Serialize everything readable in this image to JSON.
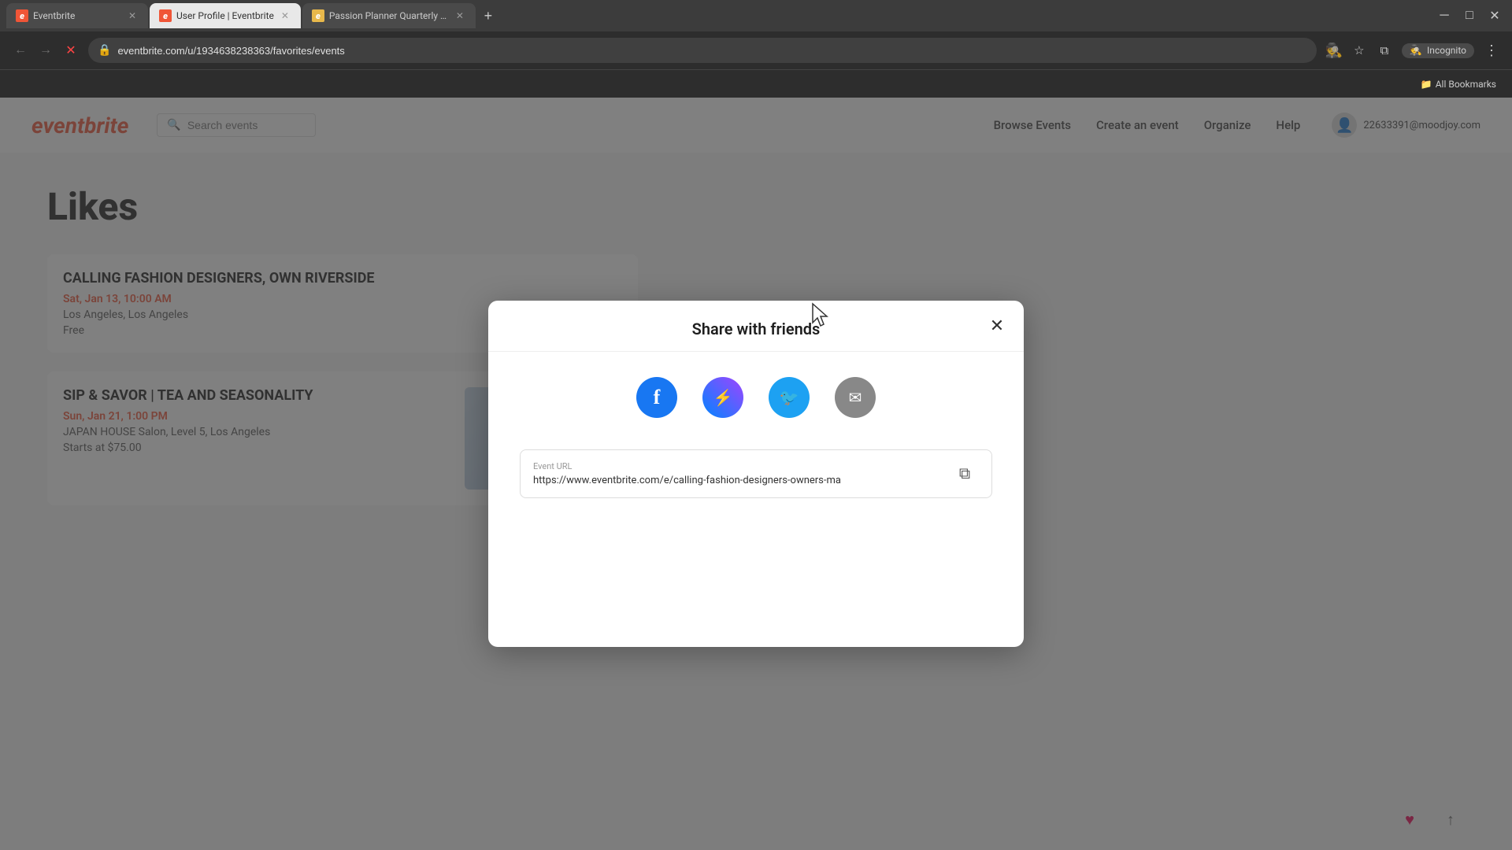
{
  "browser": {
    "tabs": [
      {
        "id": "tab-1",
        "label": "Eventbrite",
        "favicon": "E",
        "faviconColor": "eventbrite",
        "active": false,
        "closable": true
      },
      {
        "id": "tab-2",
        "label": "User Profile | Eventbrite",
        "favicon": "E",
        "faviconColor": "eventbrite",
        "active": true,
        "closable": true
      },
      {
        "id": "tab-3",
        "label": "Passion Planner Quarterly Che",
        "favicon": "e",
        "faviconColor": "passion",
        "active": false,
        "closable": true
      }
    ],
    "url": "eventbrite.com/u/1934638238363/favorites/events",
    "url_full": "eventbrite.com/u/1934638238363/favorites/events",
    "incognito_label": "Incognito",
    "bookmarks_label": "All Bookmarks"
  },
  "header": {
    "logo": "eventbrite",
    "search_placeholder": "Search events",
    "nav_items": [
      "Browse Events",
      "Create an event",
      "Organize",
      "Help"
    ],
    "user_email": "22633391@moodjoy.com"
  },
  "page": {
    "title": "Likes",
    "events": [
      {
        "title": "CALLING FASHION DESIGNERS, OWN RIVERSIDE",
        "date": "Sat, Jan 13, 10:00 AM",
        "location": "Los Angeles, Los Angeles",
        "price": "Free",
        "has_image": false
      },
      {
        "title": "Sip & Savor | Tea and Seasonality",
        "date": "Sun, Jan 21, 1:00 PM",
        "location": "JAPAN HOUSE Salon, Level 5, Los Angeles",
        "price": "Starts at $75.00",
        "has_image": true
      }
    ]
  },
  "modal": {
    "title": "Share with friends",
    "close_label": "✕",
    "share_icons": [
      {
        "name": "facebook",
        "label": "f",
        "aria": "Share on Facebook"
      },
      {
        "name": "messenger",
        "label": "m",
        "aria": "Share on Messenger"
      },
      {
        "name": "twitter",
        "label": "t",
        "aria": "Share on Twitter"
      },
      {
        "name": "email",
        "label": "✉",
        "aria": "Share via Email"
      }
    ],
    "url_section": {
      "label": "Event URL",
      "value": "https://www.eventbrite.com/e/calling-fashion-designers-owners-ma",
      "copy_aria": "Copy URL"
    }
  },
  "icons": {
    "search": "🔍",
    "user": "👤",
    "heart": "♥",
    "share": "↑",
    "copy": "⧉",
    "facebook": "f",
    "back": "←",
    "forward": "→",
    "reload": "↻",
    "home": "⌂",
    "lock": "🔒",
    "incognito": "🕵",
    "star": "☆",
    "window": "⧉",
    "more": "⋮"
  }
}
